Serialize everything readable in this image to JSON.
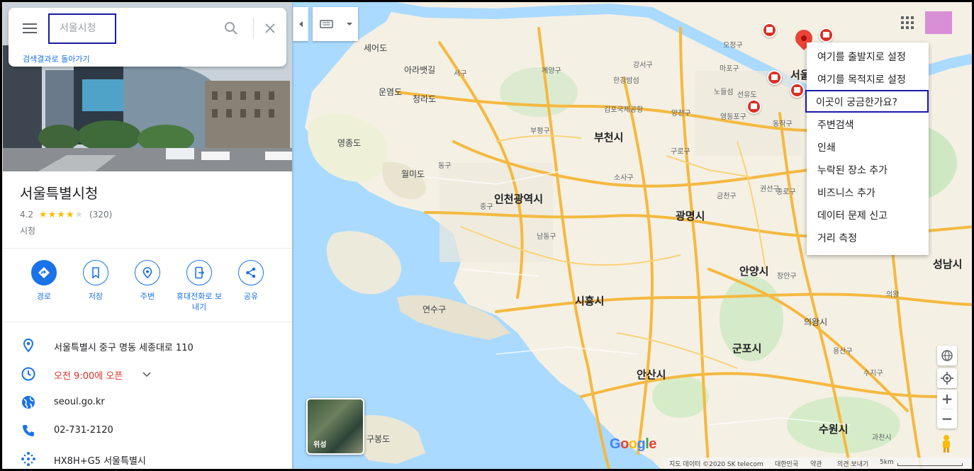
{
  "search": {
    "value": "서울시청",
    "back_link": "검색결과로 돌아가기"
  },
  "place": {
    "title": "서울특별시청",
    "rating": "4.2",
    "stars_filled": 4,
    "reviews": "(320)",
    "category": "시청"
  },
  "actions": [
    {
      "label": "경로"
    },
    {
      "label": "저장"
    },
    {
      "label": "주변"
    },
    {
      "label": "휴대전화로 보내기"
    },
    {
      "label": "공유"
    }
  ],
  "info": {
    "address": "서울특별시 중구 명동 세종대로 110",
    "hours": "오전 9:00에 오픈",
    "website": "seoul.go.kr",
    "phone": "02-731-2120",
    "plus_code": "HX8H+G5 서울특별시"
  },
  "context_menu": {
    "items": [
      "여기를 출발지로 설정",
      "여기를 목적지로 설정",
      "이곳이 궁금한가요?",
      "주변검색",
      "인쇄",
      "누락된 장소 추가",
      "비즈니스 추가",
      "데이터 문제 신고",
      "거리 측정"
    ],
    "highlighted_index": 2
  },
  "map": {
    "labels_big": [
      "인천광역시",
      "부천시",
      "광명시",
      "안양시",
      "시흥시",
      "안산시",
      "군포시",
      "수원시",
      "성남시",
      "서울"
    ],
    "labels_mid": [
      "영종도",
      "월미도",
      "연수구",
      "구봉도",
      "의왕시",
      "세어도",
      "청라도",
      "운염도",
      "아라뱃길"
    ],
    "labels_small": [
      "강서구",
      "양천구",
      "구로구",
      "금천구",
      "소사구",
      "부평구",
      "남동구",
      "계양구",
      "서구",
      "동구",
      "중구",
      "마포구",
      "영등포구",
      "동작구",
      "노들섬",
      "선유도",
      "한강밤섬",
      "김포국제공항",
      "오정구",
      "종로구",
      "용산구",
      "과천시",
      "수지구",
      "권선구",
      "장안구",
      "의왕",
      "안산",
      "팔달구"
    ],
    "satellite_label": "위성",
    "logo": "Google",
    "attribution": [
      "지도 데이터 ©2020 SK telecom",
      "대한민국",
      "약관",
      "의견 보내기",
      "5km"
    ]
  },
  "colors": {
    "accent": "#1a73e8",
    "road": "#f4b940",
    "water": "#aadaff",
    "land": "#f5f0e4",
    "hours_red": "#d93025"
  }
}
